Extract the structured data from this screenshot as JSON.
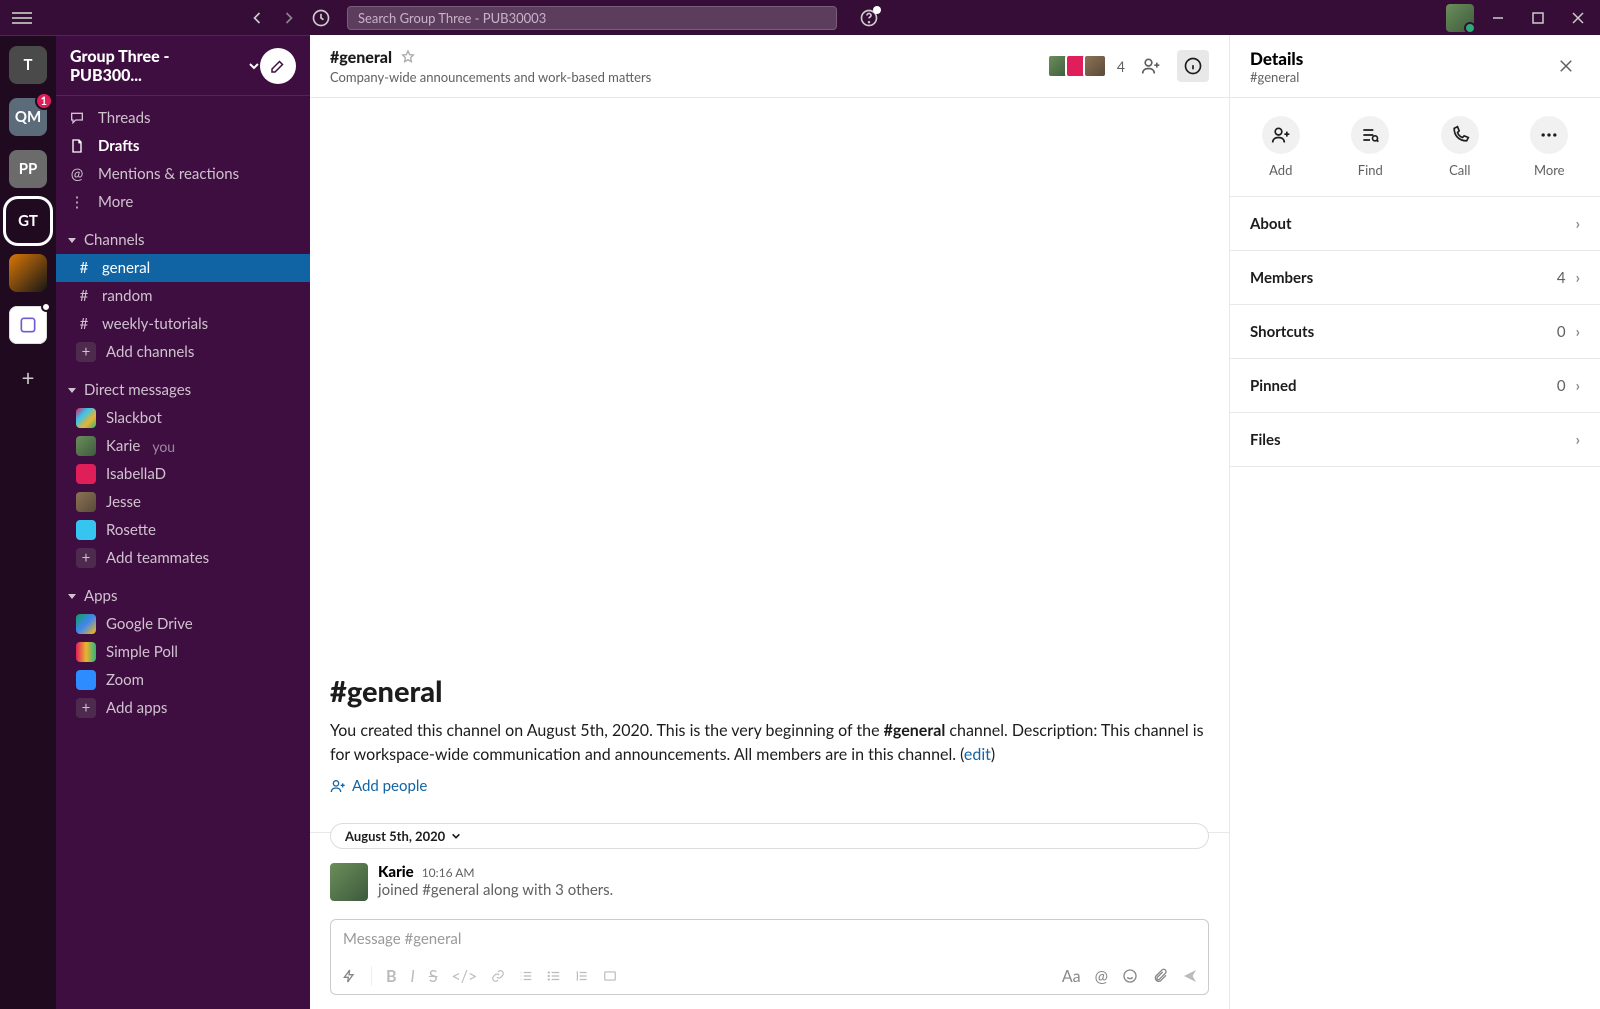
{
  "titlebar": {
    "search_placeholder": "Search Group Three - PUB30003"
  },
  "workspaces": [
    {
      "initials": "T",
      "bg": "#4a4a4a",
      "selected": false
    },
    {
      "initials": "QM",
      "bg": "#5b6b7a",
      "selected": false,
      "badge": "1"
    },
    {
      "initials": "PP",
      "bg": "#6b6b6b",
      "selected": false
    },
    {
      "initials": "GT",
      "bg": "#1f0a20",
      "selected": true
    },
    {
      "initials": "",
      "bg": "linear-gradient(135deg,#d97706,#161616)",
      "selected": false,
      "img": true
    },
    {
      "initials": "",
      "bg": "#fff",
      "selected": false,
      "img": true,
      "dot": true
    }
  ],
  "sidebar": {
    "workspace_name": "Group Three - PUB300...",
    "nav": {
      "threads": "Threads",
      "drafts": "Drafts",
      "mentions": "Mentions & reactions",
      "more": "More"
    },
    "sections": {
      "channels": "Channels",
      "dms": "Direct messages",
      "apps": "Apps"
    },
    "channels": [
      {
        "name": "general",
        "active": true
      },
      {
        "name": "random"
      },
      {
        "name": "weekly-tutorials"
      }
    ],
    "add_channels": "Add channels",
    "dms": [
      {
        "name": "Slackbot",
        "color": "linear-gradient(135deg,#e01e5a,#36c5f0,#ecb22e,#2eb67d)"
      },
      {
        "name": "Karie",
        "you": "you",
        "color": "linear-gradient(135deg,#6b8e5a,#3d5a3d)"
      },
      {
        "name": "IsabellaD",
        "color": "#e01e5a"
      },
      {
        "name": "Jesse",
        "color": "linear-gradient(135deg,#8b7355,#5a4a3a)"
      },
      {
        "name": "Rosette",
        "color": "#36c5f0"
      }
    ],
    "add_teammates": "Add teammates",
    "apps_list": [
      {
        "name": "Google Drive",
        "color": "linear-gradient(135deg,#0f9d58,#4285f4,#fbbc04)"
      },
      {
        "name": "Simple Poll",
        "color": "linear-gradient(90deg,#e01e5a,#ecb22e,#2eb67d)"
      },
      {
        "name": "Zoom",
        "color": "#2d8cff"
      }
    ],
    "add_apps": "Add apps"
  },
  "channel": {
    "name": "#general",
    "topic": "Company-wide announcements and work-based matters",
    "member_count": "4",
    "intro_title": "#general",
    "intro_l1a": "You created this channel on August 5th, 2020. This is the very beginning of the ",
    "intro_bold": "#general",
    "intro_l1b": " channel. Description: This channel is for workspace-wide communication and announcements. All members are in this channel. (",
    "intro_edit": "edit",
    "intro_l1c": ")",
    "add_people": "Add people",
    "date_chip": "August 5th, 2020",
    "message": {
      "author": "Karie",
      "time": "10:16 AM",
      "text": "joined #general along with 3 others."
    },
    "composer_placeholder": "Message #general"
  },
  "details": {
    "title": "Details",
    "subtitle": "#general",
    "actions": {
      "add": "Add",
      "find": "Find",
      "call": "Call",
      "more": "More"
    },
    "rows": {
      "about": "About",
      "members": "Members",
      "members_count": "4",
      "shortcuts": "Shortcuts",
      "shortcuts_count": "0",
      "pinned": "Pinned",
      "pinned_count": "0",
      "files": "Files"
    }
  }
}
